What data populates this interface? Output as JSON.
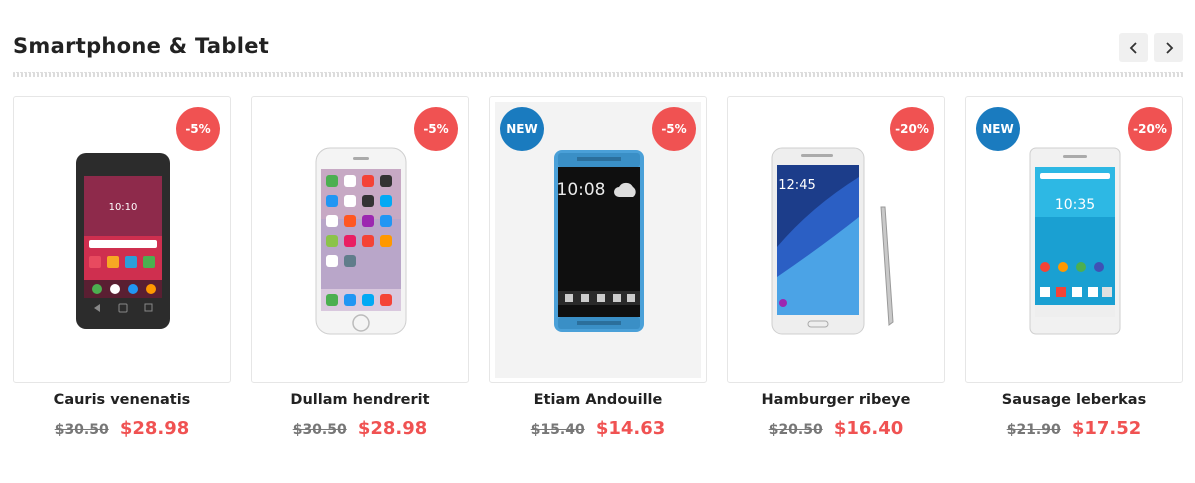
{
  "header": {
    "title": "Smartphone & Tablet",
    "prev_icon": "chevron-left-icon",
    "next_icon": "chevron-right-icon"
  },
  "colors": {
    "sale_badge": "#f05252",
    "new_badge": "#1a7bbf",
    "price": "#f05252"
  },
  "products": [
    {
      "name": "Cauris venenatis",
      "old_price": "$30.50",
      "price": "$28.98",
      "discount": "-5%",
      "new_label": "",
      "image": "smartphone-black-image"
    },
    {
      "name": "Dullam hendrerit",
      "old_price": "$30.50",
      "price": "$28.98",
      "discount": "-5%",
      "new_label": "",
      "image": "iphone-white-image"
    },
    {
      "name": "Etiam Andouille",
      "old_price": "$15.40",
      "price": "$14.63",
      "discount": "-5%",
      "new_label": "NEW",
      "image": "htc-blue-phone-image"
    },
    {
      "name": "Hamburger ribeye",
      "old_price": "$20.50",
      "price": "$16.40",
      "discount": "-20%",
      "new_label": "",
      "image": "galaxy-note-image"
    },
    {
      "name": "Sausage leberkas",
      "old_price": "$21.90",
      "price": "$17.52",
      "discount": "-20%",
      "new_label": "NEW",
      "image": "xperia-white-image"
    }
  ]
}
